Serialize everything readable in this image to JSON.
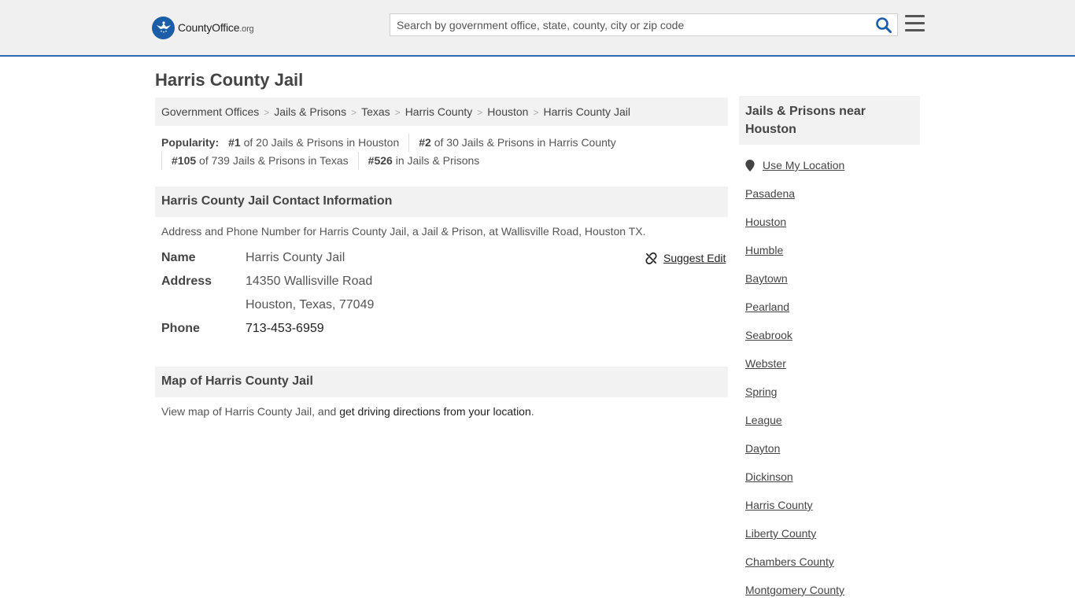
{
  "header": {
    "logo_brand_a": "County",
    "logo_brand_b": "Office",
    "logo_tld": ".org",
    "search_placeholder": "Search by government office, state, county, city or zip code",
    "colors": {
      "accent": "#2a6ab2",
      "logo_blue": "#1c5da8",
      "topbar_bg": "#f0f0f0"
    }
  },
  "page_title": "Harris County Jail",
  "breadcrumb": [
    "Government Offices",
    "Jails & Prisons",
    "Texas",
    "Harris County",
    "Houston",
    "Harris County Jail"
  ],
  "popularity": {
    "label": "Popularity:",
    "items": [
      {
        "rank": "#1",
        "text": " of 20 Jails & Prisons in Houston"
      },
      {
        "rank": "#2",
        "text": " of 30 Jails & Prisons in Harris County"
      },
      {
        "rank": "#105",
        "text": " of 739 Jails & Prisons in Texas"
      },
      {
        "rank": "#526",
        "text": " in Jails & Prisons"
      }
    ]
  },
  "contact": {
    "heading": "Harris County Jail Contact Information",
    "description": "Address and Phone Number for Harris County Jail, a Jail & Prison, at Wallisville Road, Houston TX.",
    "suggest_edit": "Suggest Edit",
    "name_label": "Name",
    "name_value": "Harris County Jail",
    "address_label": "Address",
    "address_line1": "14350 Wallisville Road",
    "address_line2": "Houston, Texas, 77049",
    "phone_label": "Phone",
    "phone_value": "713-453-6959"
  },
  "map": {
    "heading": "Map of Harris County Jail",
    "desc_prefix": "View map of Harris County Jail, and ",
    "directions_link": "get driving directions from your location",
    "desc_suffix": "."
  },
  "sidebar": {
    "heading": "Jails & Prisons near Houston",
    "use_location": "Use My Location",
    "items": [
      "Pasadena",
      "Houston",
      "Humble",
      "Baytown",
      "Pearland",
      "Seabrook",
      "Webster",
      "Spring",
      "League",
      "Dayton",
      "Dickinson",
      "Harris County",
      "Liberty County",
      "Chambers County",
      "Montgomery County"
    ]
  }
}
